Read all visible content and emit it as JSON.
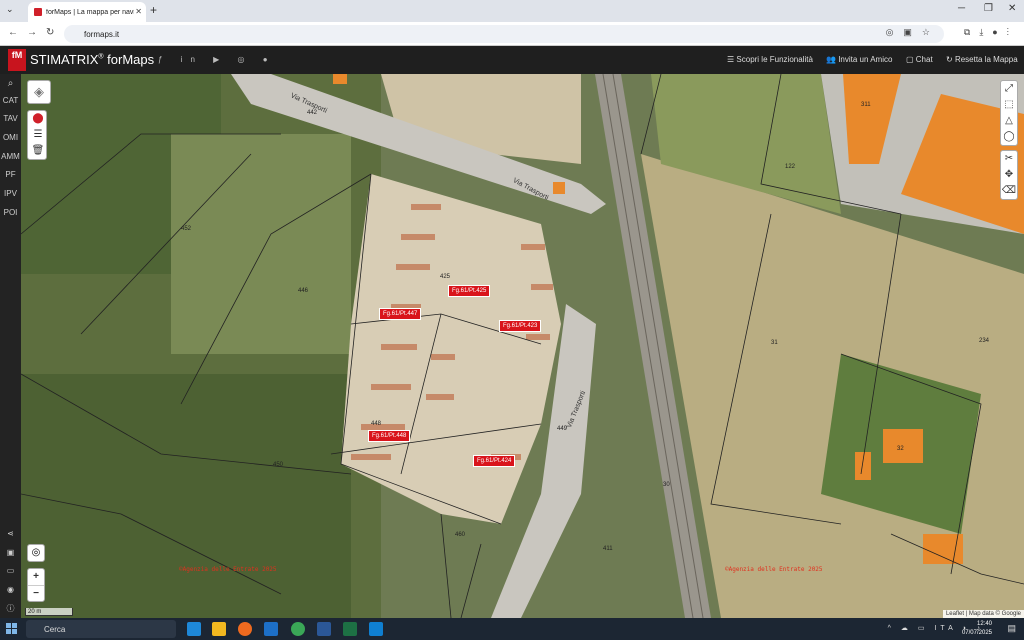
{
  "browser": {
    "tab_title": "forMaps | La mappa per navig...",
    "url": "formaps.it",
    "new_tab": "+",
    "close_tab": "✕"
  },
  "app": {
    "logo_text": "fM",
    "brand_name": "STIMATRIX",
    "brand_reg": "®",
    "brand_product": "forMaps",
    "header_links": [
      "Scopri le Funzionalità",
      "Invita un Amico",
      "Chat",
      "Resetta la Mappa"
    ]
  },
  "sidebar": {
    "items": [
      "CAT",
      "TAV",
      "OMI",
      "AMM",
      "PF",
      "IPV",
      "POI"
    ]
  },
  "map": {
    "parcel_labels": [
      "Fg.61/Pt.425",
      "Fg.61/Pt.447",
      "Fg.61/Pt.423",
      "Fg.61/Pt.448",
      "Fg.61/Pt.424"
    ],
    "parcel_numbers": [
      "425",
      "446",
      "448",
      "452",
      "450",
      "460",
      "411",
      "122",
      "31",
      "234",
      "32",
      "30",
      "311",
      "449",
      "442"
    ],
    "streets": [
      "Via Trasporti",
      "Via Trasporti",
      "Via Trasporti"
    ],
    "watermarks": [
      "©Agenzia delle Entrate 2025",
      "©Agenzia delle Entrate 2025"
    ],
    "scale_text": "20 m",
    "attribution": "Leaflet | Map data © Google",
    "zoom_in": "+",
    "zoom_out": "−"
  },
  "taskbar": {
    "search_placeholder": "Cerca",
    "language": "ITA",
    "time": "12:40",
    "date": "07/07/2025"
  },
  "colors": {
    "header_bg": "#1f1f1f",
    "accent_red": "#d9141b",
    "building_orange": "#e8892c"
  }
}
